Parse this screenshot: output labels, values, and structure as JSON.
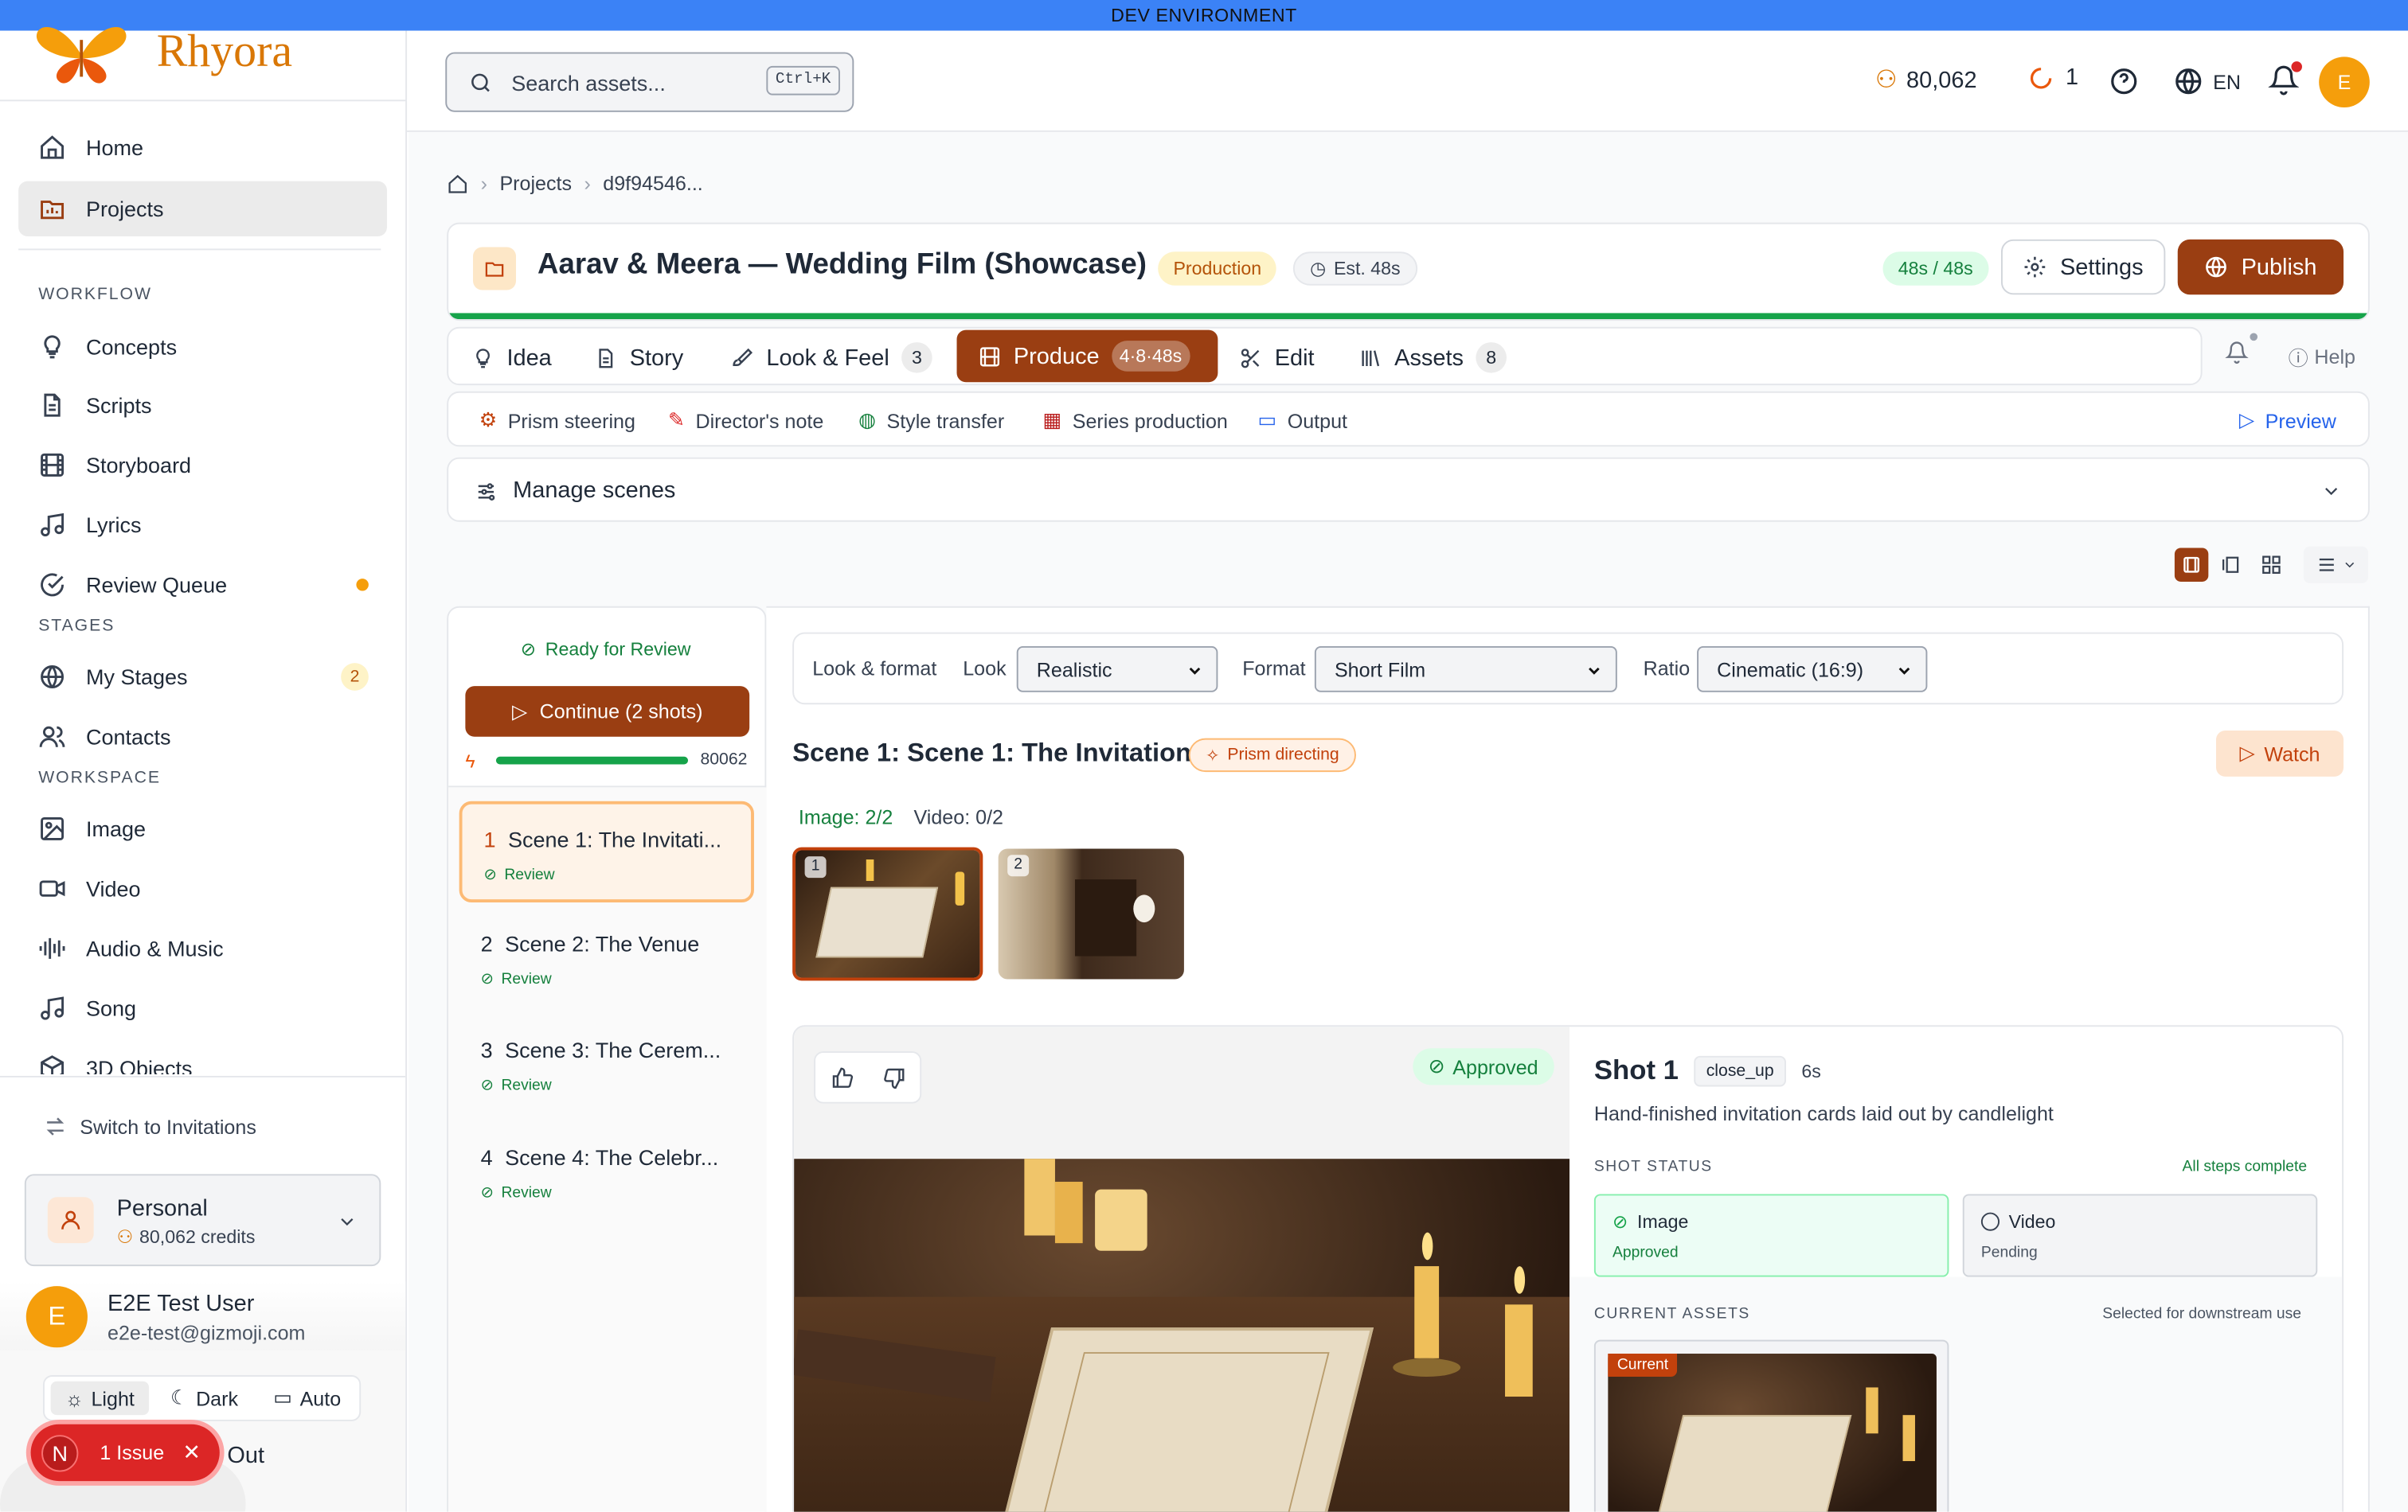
{
  "dev_banner": "DEV ENVIRONMENT",
  "brand": {
    "name": "Rhyora"
  },
  "sidebar": {
    "nav": [
      {
        "label": "Home",
        "icon": "home-icon"
      },
      {
        "label": "Projects",
        "icon": "projects-icon"
      }
    ],
    "workflow_title": "WORKFLOW",
    "workflow": [
      {
        "label": "Concepts",
        "icon": "lightbulb-icon"
      },
      {
        "label": "Scripts",
        "icon": "script-icon"
      },
      {
        "label": "Storyboard",
        "icon": "film-icon"
      },
      {
        "label": "Lyrics",
        "icon": "music-icon"
      },
      {
        "label": "Review Queue",
        "icon": "check-circle-icon"
      }
    ],
    "stages_title": "STAGES",
    "stages": [
      {
        "label": "My Stages",
        "icon": "globe-icon",
        "count": "2"
      },
      {
        "label": "Contacts",
        "icon": "contacts-icon"
      }
    ],
    "workspace_title": "WORKSPACE",
    "workspace": [
      {
        "label": "Image",
        "icon": "image-icon"
      },
      {
        "label": "Video",
        "icon": "video-icon"
      },
      {
        "label": "Audio & Music",
        "icon": "audio-icon"
      },
      {
        "label": "Song",
        "icon": "music-icon"
      },
      {
        "label": "3D Objects",
        "icon": "cube-icon"
      }
    ],
    "switch_label": "Switch to Invitations",
    "account": {
      "name": "Personal",
      "credits": "80,062 credits"
    },
    "user": {
      "initial": "E",
      "name": "E2E Test User",
      "email": "e2e-test@gizmoji.com"
    },
    "theme": {
      "light": "Light",
      "dark": "Dark",
      "auto": "Auto"
    },
    "issue": {
      "initial": "N",
      "label": "1 Issue"
    },
    "sign_out_fragment": "Out"
  },
  "topbar": {
    "search_placeholder": "Search assets...",
    "shortcut": "Ctrl+K",
    "credits": "80,062",
    "jobs": "1",
    "language": "EN",
    "avatar": "E"
  },
  "breadcrumb": {
    "projects": "Projects",
    "current": "d9f94546..."
  },
  "project": {
    "title": "Aarav & Meera — Wedding Film (Showcase)",
    "status": "Production",
    "estimate": "Est. 48s",
    "duration": "48s / 48s",
    "settings": "Settings",
    "publish": "Publish",
    "progress": 1.0
  },
  "tabs": [
    {
      "label": "Idea"
    },
    {
      "label": "Story"
    },
    {
      "label": "Look & Feel",
      "count": "3"
    },
    {
      "label": "Produce",
      "count": "4·8·48s"
    },
    {
      "label": "Edit"
    },
    {
      "label": "Assets",
      "count": "8"
    }
  ],
  "help": "Help",
  "subtabs": [
    {
      "label": "Prism steering"
    },
    {
      "label": "Director's note"
    },
    {
      "label": "Style transfer"
    },
    {
      "label": "Series production"
    },
    {
      "label": "Output"
    }
  ],
  "preview": "Preview",
  "manage_scenes": "Manage scenes",
  "scene_panel": {
    "ready": "Ready for Review",
    "continue": "Continue (2 shots)",
    "credits": "80062",
    "scenes": [
      {
        "num": "1",
        "title": "Scene 1: The Invitati...",
        "status": "Review"
      },
      {
        "num": "2",
        "title": "Scene 2: The Venue",
        "status": "Review"
      },
      {
        "num": "3",
        "title": "Scene 3: The Cerem...",
        "status": "Review"
      },
      {
        "num": "4",
        "title": "Scene 4: The Celebr...",
        "status": "Review"
      }
    ]
  },
  "format_bar": {
    "title": "Look & format",
    "look_label": "Look",
    "look_value": "Realistic",
    "format_label": "Format",
    "format_value": "Short Film",
    "ratio_label": "Ratio",
    "ratio_value": "Cinematic (16:9)"
  },
  "scene": {
    "title": "Scene 1: Scene 1: The Invitation",
    "badge": "Prism directing",
    "watch": "Watch",
    "image_count": "Image: 2/2",
    "video_count": "Video: 0/2",
    "thumbs": [
      "1",
      "2"
    ]
  },
  "shot": {
    "approved": "Approved",
    "title": "Shot 1",
    "type": "close_up",
    "duration": "6s",
    "description": "Hand-finished invitation cards laid out by candlelight",
    "status_title": "SHOT STATUS",
    "all_steps": "All steps complete",
    "image_label": "Image",
    "image_status": "Approved",
    "video_label": "Video",
    "video_status": "Pending",
    "assets_title": "CURRENT ASSETS",
    "assets_note": "Selected for downstream use",
    "current_badge": "Current"
  },
  "colors": {
    "accent": "#9a3e12",
    "banner": "#3b82f6",
    "success": "#16a34a"
  }
}
